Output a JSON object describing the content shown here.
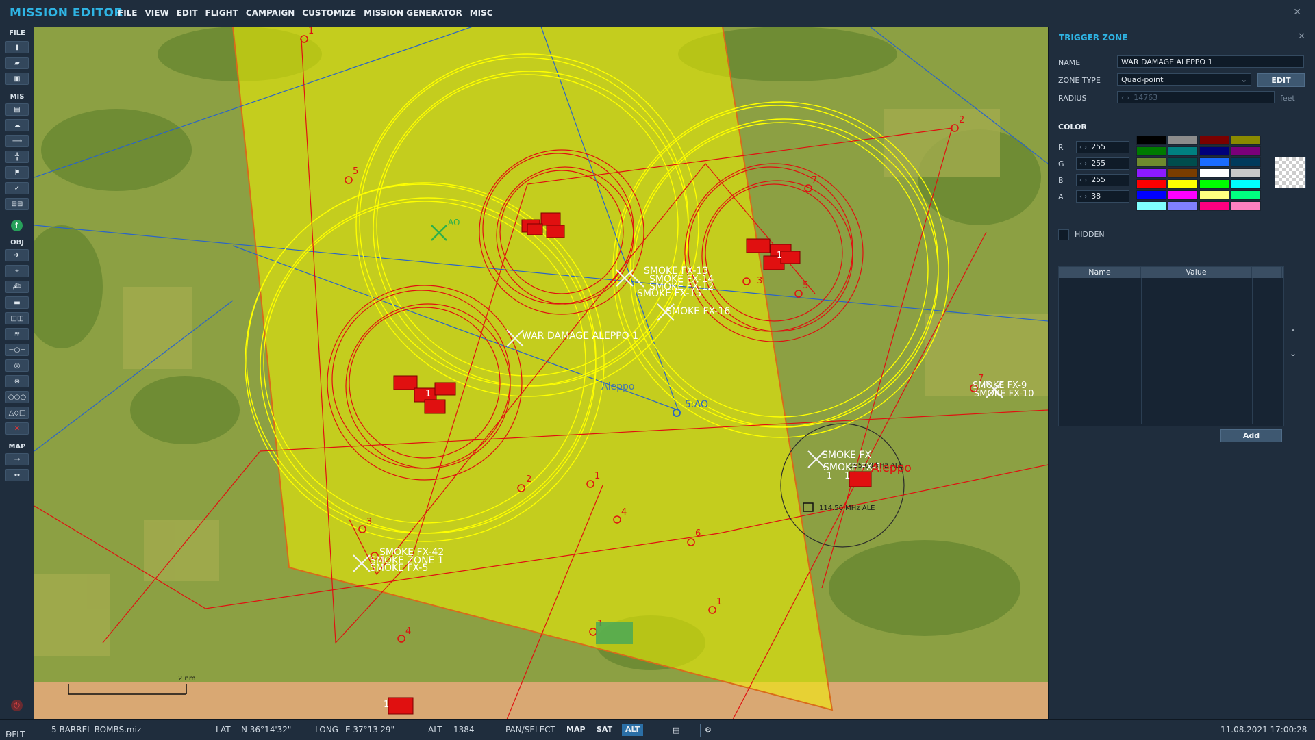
{
  "app": {
    "title": "MISSION EDITOR",
    "close_icon": "close-icon"
  },
  "menu": [
    "FILE",
    "VIEW",
    "EDIT",
    "FLIGHT",
    "CAMPAIGN",
    "CUSTOMIZE",
    "MISSION GENERATOR",
    "MISC"
  ],
  "toolbar": {
    "sections": {
      "file": "FILE",
      "mis": "MIS",
      "obj": "OBJ",
      "map": "MAP"
    },
    "file_buttons": [
      "new-mission-icon",
      "open-mission-icon",
      "save-mission-icon"
    ],
    "mis_buttons": [
      "briefing-icon",
      "weather-icon",
      "aircraft-route-icon",
      "airbase-icon",
      "triggers-icon",
      "goals-icon",
      "resource-icon"
    ],
    "obj_buttons": [
      "plane-icon",
      "helicopter-icon",
      "ship-icon",
      "ground-vehicle-icon",
      "static-object-icon",
      "trigger-zone-icon",
      "template-icon",
      "nav-point-icon",
      "bullseye-icon",
      "shape-icon",
      "delete-icon"
    ],
    "map_buttons": [
      "ruler-icon",
      "zoom-icon"
    ]
  },
  "map": {
    "scale_label": "2 nm",
    "labels": {
      "war_damage": "WAR DAMAGE ALEPPO 1",
      "smoke13": "SMOKE FX-13",
      "smoke14": "SMOKE FX-14",
      "smoke12": "SMOKE FX-12",
      "smoke15": "SMOKE FX-15",
      "smoke16": "SMOKE FX-16",
      "smoke9": "SMOKE FX-9",
      "smoke10": "SMOKE FX-10",
      "smoke": "SMOKE FX",
      "smoke1": "SMOKE FX-1",
      "smoke42": "SMOKE FX-42",
      "smokezone": "SMOKE ZONE 1",
      "smoke5": "SMOKE FX-5",
      "aleppo_blue": "Aleppo",
      "aleppo_red": "Aleppo",
      "ao": "AO",
      "five_ao": "5:AO",
      "freq1": "114.50 MHz ALE",
      "freq2": "395.00 kHz ALE"
    }
  },
  "panel": {
    "title": "TRIGGER ZONE",
    "name_label": "NAME",
    "name_value": "WAR DAMAGE ALEPPO 1",
    "zone_type_label": "ZONE TYPE",
    "zone_type_value": "Quad-point",
    "edit_label": "EDIT",
    "radius_label": "RADIUS",
    "radius_value": "14763",
    "radius_unit": "feet",
    "color_label": "COLOR",
    "r_label": "R",
    "r_value": "255",
    "g_label": "G",
    "g_value": "255",
    "b_label": "B",
    "b_value": "255",
    "a_label": "A",
    "a_value": "38",
    "palette": [
      "#000000",
      "#8c8c8c",
      "#7a0000",
      "#8a8a00",
      "#007a00",
      "#008080",
      "#00007a",
      "#7a007a",
      "#6e8a2e",
      "#004d4d",
      "#1a6cff",
      "#003a5c",
      "#8c1aff",
      "#7a3d00",
      "#ffffff",
      "#c8c8c8",
      "#ff0000",
      "#ffff00",
      "#00ff00",
      "#00ffff",
      "#0000ff",
      "#ff00ff",
      "#ffff80",
      "#00ff80",
      "#80ffff",
      "#8080ff",
      "#ff0080",
      "#ff80c0"
    ],
    "hidden_label": "HIDDEN",
    "table_headers": [
      "Name",
      "Value"
    ],
    "add_label": "Add"
  },
  "status": {
    "profile": "DFLT",
    "file": "5 BARREL BOMBS.miz",
    "lat_label": "LAT",
    "lat_value": "N 36°14'32\"",
    "long_label": "LONG",
    "long_value": "E 37°13'29\"",
    "alt_label": "ALT",
    "alt_value": "1384",
    "pan_select": "PAN/SELECT",
    "map_btn": "MAP",
    "sat_btn": "SAT",
    "alt_btn": "ALT",
    "datetime": "11.08.2021 17:00:28"
  },
  "colors": {
    "accent": "#2fb4e4",
    "zone_fill": "#f2f200",
    "route": "#e01010",
    "map_green": "#7f9a3c"
  }
}
